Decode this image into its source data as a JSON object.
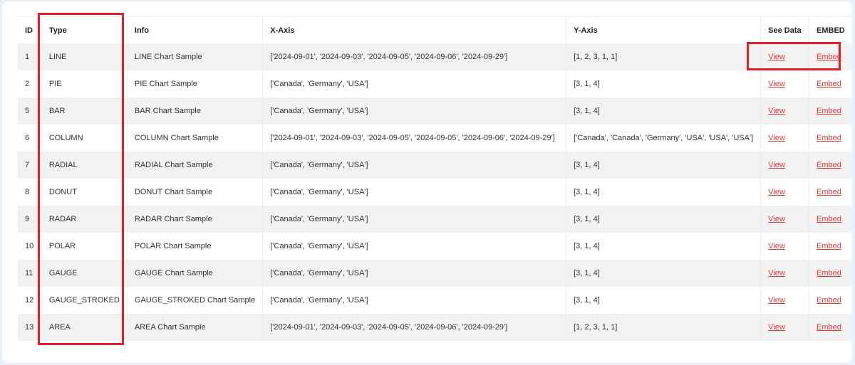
{
  "table": {
    "headers": {
      "id": "ID",
      "type": "Type",
      "info": "Info",
      "x_axis": "X-Axis",
      "y_axis": "Y-Axis",
      "see_data": "See Data",
      "embed": "EMBED"
    },
    "rows": [
      {
        "id": "1",
        "type": "LINE",
        "info": "LINE Chart Sample",
        "x_axis": "['2024-09-01', '2024-09-03', '2024-09-05', '2024-09-06', '2024-09-29']",
        "y_axis": "[1, 2, 3, 1, 1]",
        "view": "View",
        "embed": "Embed"
      },
      {
        "id": "2",
        "type": "PIE",
        "info": "PIE Chart Sample",
        "x_axis": "['Canada', 'Germany', 'USA']",
        "y_axis": "[3, 1, 4]",
        "view": "View",
        "embed": "Embed"
      },
      {
        "id": "5",
        "type": "BAR",
        "info": "BAR Chart Sample",
        "x_axis": "['Canada', 'Germany', 'USA']",
        "y_axis": "[3, 1, 4]",
        "view": "View",
        "embed": "Embed"
      },
      {
        "id": "6",
        "type": "COLUMN",
        "info": "COLUMN Chart Sample",
        "x_axis": "['2024-09-01', '2024-09-03', '2024-09-05', '2024-09-05', '2024-09-06', '2024-09-29']",
        "y_axis": "['Canada', 'Canada', 'Germany', 'USA', 'USA', 'USA']",
        "view": "View",
        "embed": "Embed"
      },
      {
        "id": "7",
        "type": "RADIAL",
        "info": "RADIAL Chart Sample",
        "x_axis": "['Canada', 'Germany', 'USA']",
        "y_axis": "[3, 1, 4]",
        "view": "View",
        "embed": "Embed"
      },
      {
        "id": "8",
        "type": "DONUT",
        "info": "DONUT Chart Sample",
        "x_axis": "['Canada', 'Germany', 'USA']",
        "y_axis": "[3, 1, 4]",
        "view": "View",
        "embed": "Embed"
      },
      {
        "id": "9",
        "type": "RADAR",
        "info": "RADAR Chart Sample",
        "x_axis": "['Canada', 'Germany', 'USA']",
        "y_axis": "[3, 1, 4]",
        "view": "View",
        "embed": "Embed"
      },
      {
        "id": "10",
        "type": "POLAR",
        "info": "POLAR Chart Sample",
        "x_axis": "['Canada', 'Germany', 'USA']",
        "y_axis": "[3, 1, 4]",
        "view": "View",
        "embed": "Embed"
      },
      {
        "id": "11",
        "type": "GAUGE",
        "info": "GAUGE Chart Sample",
        "x_axis": "['Canada', 'Germany', 'USA']",
        "y_axis": "[3, 1, 4]",
        "view": "View",
        "embed": "Embed"
      },
      {
        "id": "12",
        "type": "GAUGE_STROKED",
        "info": "GAUGE_STROKED Chart Sample",
        "x_axis": "['Canada', 'Germany', 'USA']",
        "y_axis": "[3, 1, 4]",
        "view": "View",
        "embed": "Embed"
      },
      {
        "id": "13",
        "type": "AREA",
        "info": "AREA Chart Sample",
        "x_axis": "['2024-09-01', '2024-09-03', '2024-09-05', '2024-09-06', '2024-09-29']",
        "y_axis": "[1, 2, 3, 1, 1]",
        "view": "View",
        "embed": "Embed"
      }
    ]
  },
  "colors": {
    "link": "#e53935",
    "highlight": "#e41e26",
    "page_bg": "#e8f2fc",
    "row_stripe": "#f2f2f2"
  }
}
